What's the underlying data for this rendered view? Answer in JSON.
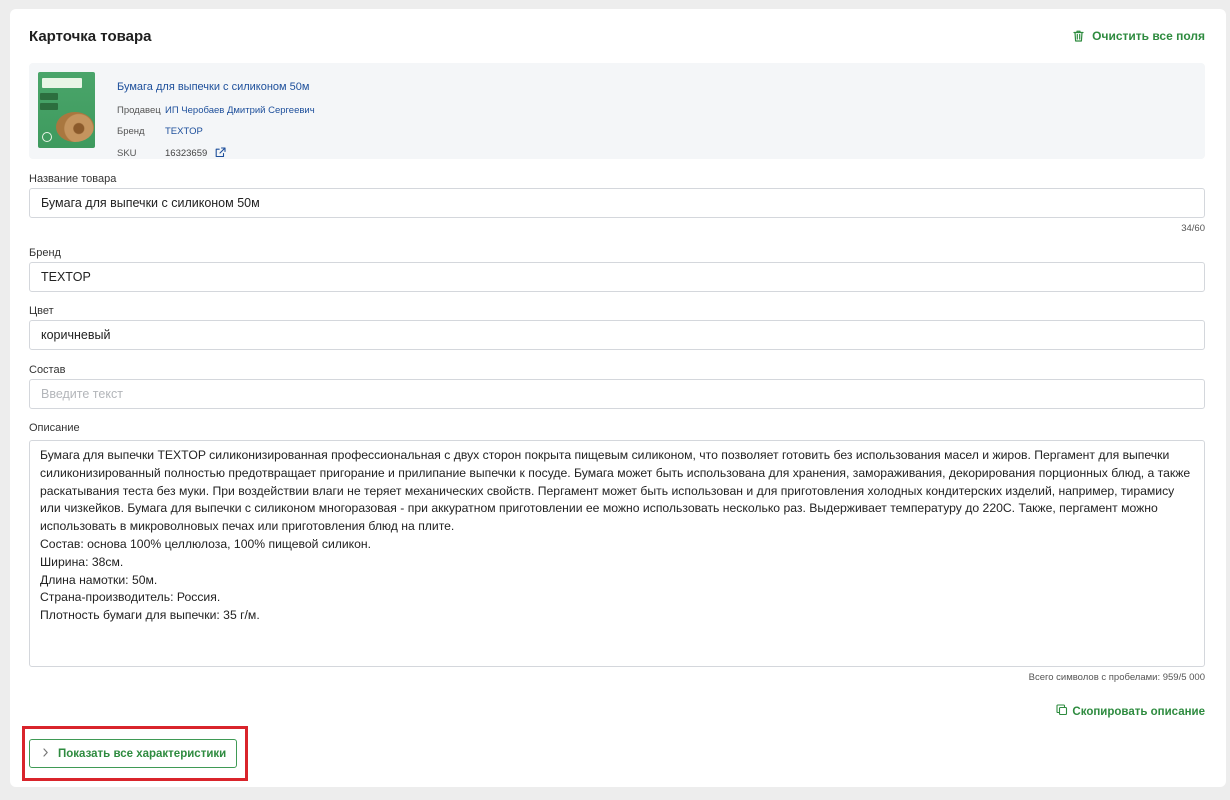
{
  "page": {
    "title": "Карточка товара",
    "clear_label": "Очистить все поля"
  },
  "product": {
    "name": "Бумага для выпечки с силиконом 50м",
    "seller_key": "Продавец",
    "seller_value": "ИП Черобаев Дмитрий Сергеевич",
    "brand_key": "Бренд",
    "brand_value": "TEXTOP",
    "sku_key": "SKU",
    "sku_value": "16323659"
  },
  "fields": {
    "name": {
      "label": "Название товара",
      "value": "Бумага для выпечки с силиконом 50м",
      "counter": "34/60"
    },
    "brand": {
      "label": "Бренд",
      "value": "TEXTOP"
    },
    "color": {
      "label": "Цвет",
      "value": "коричневый"
    },
    "composition": {
      "label": "Состав",
      "value": "",
      "placeholder": "Введите текст"
    },
    "description": {
      "label": "Описание",
      "value": "Бумага для выпечки TEXTOP силиконизированная профессиональная с двух сторон покрыта пищевым силиконом, что позволяет готовить без использования масел и жиров. Пергамент для выпечки силиконизированный полностью предотвращает пригорание и прилипание выпечки к посуде. Бумага может быть использована для хранения, замораживания, декорирования порционных блюд, а также раскатывания теста без муки. При воздействии влаги не теряет механических свойств. Пергамент может быть использован и для приготовления холодных кондитерских изделий, например, тирамису или чизкейков. Бумага для выпечки с силиконом многоразовая - при аккуратном приготовлении ее можно использовать несколько раз. Выдерживает температуру до 220С. Также, пергамент можно использовать в микроволновых печах или приготовления блюд на плите.\nСостав: основа 100% целлюлоза, 100% пищевой силикон.\nШирина: 38см.\nДлина намотки: 50м.\nСтрана-производитель: Россия.\nПлотность бумаги для выпечки: 35 г/м.",
      "counter": "Всего символов с пробелами: 959/5 000"
    }
  },
  "actions": {
    "copy_description": "Скопировать описание",
    "show_all_characteristics": "Показать все характеристики"
  },
  "colors": {
    "accent": "#2e8b3f",
    "link": "#1d4f9b",
    "highlight": "#d9242b"
  },
  "icons": {
    "clear": "trash-icon",
    "external": "external-link-icon",
    "copy": "copy-icon",
    "show": "chevron-right-icon"
  }
}
